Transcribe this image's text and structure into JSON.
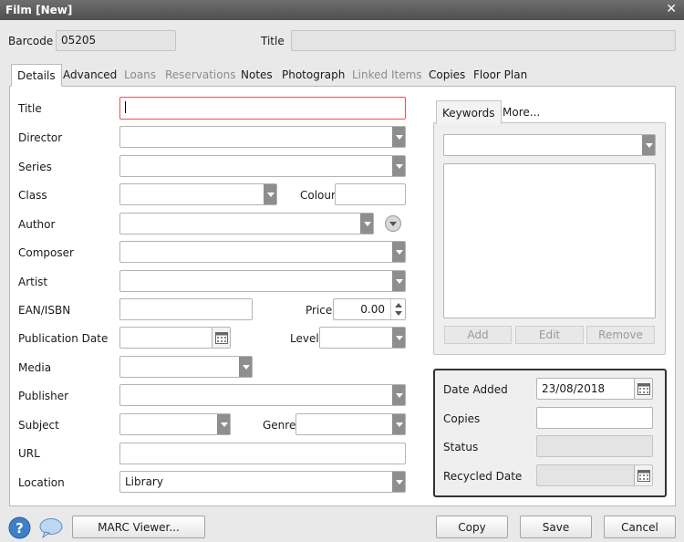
{
  "window": {
    "title": "Film [New]"
  },
  "header": {
    "barcode_label": "Barcode",
    "barcode_value": "05205",
    "title_label": "Title",
    "title_value": ""
  },
  "tabs": [
    {
      "label": "Details",
      "state": "active"
    },
    {
      "label": "Advanced",
      "state": "enabled"
    },
    {
      "label": "Loans",
      "state": "disabled"
    },
    {
      "label": "Reservations",
      "state": "disabled"
    },
    {
      "label": "Notes",
      "state": "enabled"
    },
    {
      "label": "Photograph",
      "state": "enabled"
    },
    {
      "label": "Linked Items",
      "state": "disabled"
    },
    {
      "label": "Copies",
      "state": "enabled"
    },
    {
      "label": "Floor Plan",
      "state": "enabled"
    }
  ],
  "form": {
    "title_label": "Title",
    "director_label": "Director",
    "series_label": "Series",
    "class_label": "Class",
    "colour_label": "Colour",
    "author_label": "Author",
    "composer_label": "Composer",
    "artist_label": "Artist",
    "ean_label": "EAN/ISBN",
    "price_label": "Price",
    "price_value": "0.00",
    "pubdate_label": "Publication Date",
    "level_label": "Level",
    "media_label": "Media",
    "publisher_label": "Publisher",
    "subject_label": "Subject",
    "genre_label": "Genre",
    "url_label": "URL",
    "location_label": "Location",
    "location_value": "Library"
  },
  "keywords": {
    "tab_keywords": "Keywords",
    "tab_more": "More...",
    "add_label": "Add",
    "edit_label": "Edit",
    "remove_label": "Remove"
  },
  "info": {
    "date_added_label": "Date Added",
    "date_added_value": "23/08/2018",
    "copies_label": "Copies",
    "status_label": "Status",
    "recycled_label": "Recycled Date"
  },
  "footer": {
    "marc_label": "MARC Viewer...",
    "copy_label": "Copy",
    "save_label": "Save",
    "cancel_label": "Cancel"
  },
  "icons": {
    "close": "close-icon",
    "help": "help-icon",
    "chat": "chat-bubble-icon",
    "calendar": "calendar-icon",
    "author_lookup": "author-dropdown-circle-icon"
  },
  "colors": {
    "titlebar": "#5a5a5a",
    "focus_border": "#e25656",
    "help_icon": "#3f7fc6",
    "combo_button": "#8e8e8e"
  }
}
